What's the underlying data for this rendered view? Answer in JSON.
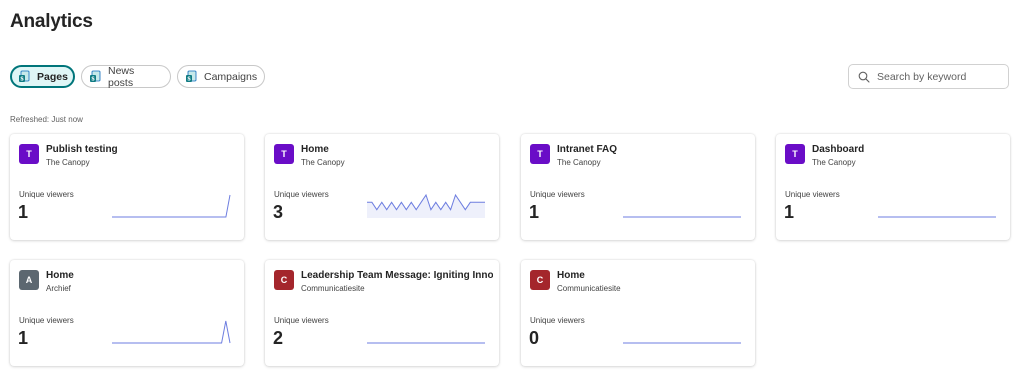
{
  "header": {
    "title": "Analytics"
  },
  "tabs": [
    {
      "label": "Pages",
      "active": true,
      "icon": "page-icon"
    },
    {
      "label": "News posts",
      "active": false,
      "icon": "news-icon"
    },
    {
      "label": "Campaigns",
      "active": false,
      "icon": "campaign-icon"
    }
  ],
  "search": {
    "placeholder": "Search by keyword",
    "value": ""
  },
  "status": {
    "refreshed": "Refreshed: Just now"
  },
  "colors": {
    "accent": "#00757a",
    "sparkline": "#6e7ee0",
    "avatar_purple": "#6a0dc7",
    "avatar_gray": "#5c6770",
    "avatar_red": "#a4262c"
  },
  "viewers_label": "Unique viewers",
  "cards": [
    {
      "initial": "T",
      "avatar_color": "#6a0dc7",
      "title": "Publish testing",
      "site": "The Canopy",
      "label": "Unique viewers",
      "count": "1",
      "trend": [
        0,
        0,
        0,
        0,
        0,
        0,
        0,
        0,
        0,
        0,
        0,
        0,
        0,
        0,
        0,
        0,
        0,
        0,
        0,
        0,
        0,
        0,
        0,
        0,
        0,
        0,
        0,
        0,
        0,
        1
      ]
    },
    {
      "initial": "T",
      "avatar_color": "#6a0dc7",
      "title": "Home",
      "site": "The Canopy",
      "label": "Unique viewers",
      "count": "3",
      "trend": [
        2,
        2,
        1,
        2,
        1,
        2,
        1,
        2,
        1,
        2,
        1,
        2,
        3,
        1,
        2,
        1,
        2,
        1,
        3,
        2,
        1,
        2,
        2,
        2,
        2
      ],
      "fill": true
    },
    {
      "initial": "T",
      "avatar_color": "#6a0dc7",
      "title": "Intranet FAQ",
      "site": "The Canopy",
      "label": "Unique viewers",
      "count": "1",
      "trend": [
        0,
        0,
        0,
        0,
        0,
        0,
        0,
        0,
        0,
        0,
        0,
        0,
        0,
        0,
        0,
        0,
        0,
        0,
        0,
        0
      ]
    },
    {
      "initial": "T",
      "avatar_color": "#6a0dc7",
      "title": "Dashboard",
      "site": "The Canopy",
      "label": "Unique viewers",
      "count": "1",
      "trend": [
        0,
        0,
        0,
        0,
        0,
        0,
        0,
        0,
        0,
        0,
        0,
        0,
        0,
        0,
        0,
        0,
        0,
        0,
        0,
        0
      ]
    },
    {
      "initial": "A",
      "avatar_color": "#5c6770",
      "title": "Home",
      "site": "Archief",
      "label": "Unique viewers",
      "count": "1",
      "trend": [
        0,
        0,
        0,
        0,
        0,
        0,
        0,
        0,
        0,
        0,
        0,
        0,
        0,
        0,
        0,
        0,
        0,
        0,
        0,
        0,
        0,
        0,
        0,
        0,
        0,
        0,
        0,
        1,
        0
      ]
    },
    {
      "initial": "C",
      "avatar_color": "#a4262c",
      "title": "Leadership Team Message: Igniting Inno...",
      "site": "Communicatiesite",
      "label": "Unique viewers",
      "count": "2",
      "trend": [
        0,
        0,
        0,
        0,
        0,
        0,
        0,
        0,
        0,
        0,
        0,
        0,
        0,
        0,
        0,
        0,
        0,
        0,
        0,
        0
      ]
    },
    {
      "initial": "C",
      "avatar_color": "#a4262c",
      "title": "Home",
      "site": "Communicatiesite",
      "label": "Unique viewers",
      "count": "0",
      "trend": [
        0,
        0,
        0,
        0,
        0,
        0,
        0,
        0,
        0,
        0,
        0,
        0,
        0,
        0,
        0,
        0,
        0,
        0,
        0,
        0
      ]
    }
  ]
}
